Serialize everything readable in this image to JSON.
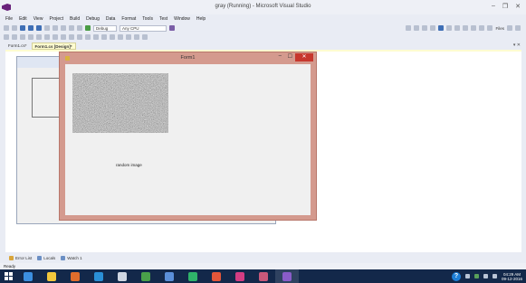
{
  "window": {
    "title": "gray (Running) - Microsoft Visual Studio",
    "minimize_glyph": "–",
    "restore_glyph": "❐",
    "close_glyph": "✕"
  },
  "menu": [
    "File",
    "Edit",
    "View",
    "Project",
    "Build",
    "Debug",
    "Data",
    "Format",
    "Tools",
    "Test",
    "Window",
    "Help"
  ],
  "toolbar": {
    "configuration": "Debug",
    "platform": "Any CPU",
    "right_label": "Files"
  },
  "tabs": [
    {
      "label": "Form1.cs*",
      "active": false
    },
    {
      "label": "Form1.cs [Design]*",
      "active": true
    }
  ],
  "tabs_overflow_glyph": "▾ ✕",
  "running_form": {
    "title": "Form1",
    "minimize_glyph": "–",
    "maximize_glyph": "☐",
    "close_glyph": "✕",
    "caption": "random image"
  },
  "tool_windows": [
    "Error List",
    "Locals",
    "Watch 1"
  ],
  "status": "Ready",
  "taskbar": {
    "help_glyph": "?",
    "time": "04:29 AM",
    "date": "09-12-2016",
    "apps": [
      {
        "name": "edge-icon",
        "color": "#3c8fe0"
      },
      {
        "name": "file-explorer-icon",
        "color": "#f2c73c"
      },
      {
        "name": "media-player-icon",
        "color": "#e06d2c"
      },
      {
        "name": "store-icon",
        "color": "#2a8fd6"
      },
      {
        "name": "settings-icon",
        "color": "#cfd6e2"
      },
      {
        "name": "photos-icon",
        "color": "#4aa04a"
      },
      {
        "name": "hp-icon",
        "color": "#5b8fd9"
      },
      {
        "name": "terminal-icon",
        "color": "#2fb36a"
      },
      {
        "name": "paint-icon",
        "color": "#e2563a"
      },
      {
        "name": "gamepad-icon",
        "color": "#d33d83"
      },
      {
        "name": "sketch-icon",
        "color": "#c8587a"
      },
      {
        "name": "visual-studio-icon",
        "color": "#8a5cc8"
      }
    ]
  }
}
